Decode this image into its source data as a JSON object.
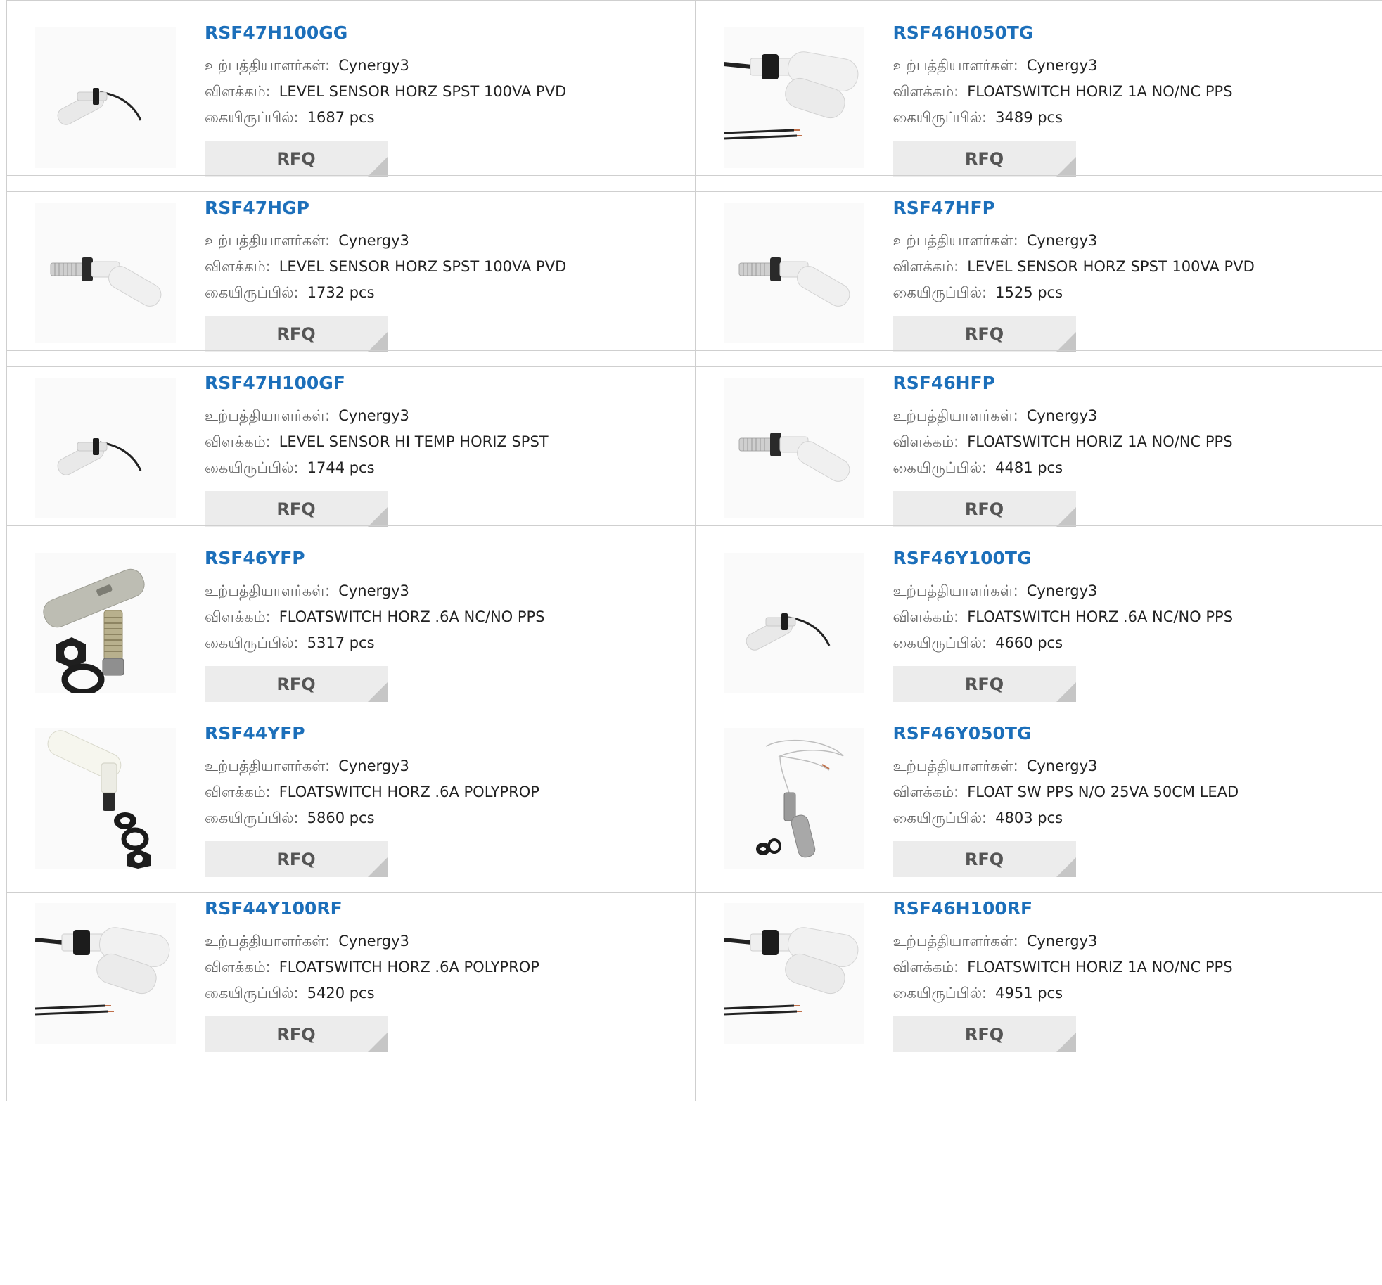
{
  "labels": {
    "manufacturer": "உற்பத்தியாளர்கள்:",
    "description": "விளக்கம்:",
    "stock": "கையிருப்பில்:",
    "rfq": "RFQ"
  },
  "products": [
    {
      "part": "RSF47H100GG",
      "manufacturer": "Cynergy3",
      "description": "LEVEL SENSOR HORZ SPST 100VA PVD",
      "stock": "1687 pcs",
      "image": "cable-float-icon"
    },
    {
      "part": "RSF46H050TG",
      "manufacturer": "Cynergy3",
      "description": "FLOATSWITCH HORIZ 1A NO/NC PPS",
      "stock": "3489 pcs",
      "image": "large-float-wires-icon"
    },
    {
      "part": "RSF47HGP",
      "manufacturer": "Cynergy3",
      "description": "LEVEL SENSOR HORZ SPST 100VA PVD",
      "stock": "1732 pcs",
      "image": "threaded-float-icon"
    },
    {
      "part": "RSF47HFP",
      "manufacturer": "Cynergy3",
      "description": "LEVEL SENSOR HORZ SPST 100VA PVD",
      "stock": "1525 pcs",
      "image": "threaded-float-icon"
    },
    {
      "part": "RSF47H100GF",
      "manufacturer": "Cynergy3",
      "description": "LEVEL SENSOR HI TEMP HORIZ SPST",
      "stock": "1744 pcs",
      "image": "cable-float-icon"
    },
    {
      "part": "RSF46HFP",
      "manufacturer": "Cynergy3",
      "description": "FLOATSWITCH HORIZ 1A NO/NC PPS",
      "stock": "4481 pcs",
      "image": "threaded-float-icon"
    },
    {
      "part": "RSF46YFP",
      "manufacturer": "Cynergy3",
      "description": "FLOATSWITCH HORZ .6A NC/NO PPS",
      "stock": "5317 pcs",
      "image": "connector-sensor-icon"
    },
    {
      "part": "RSF46Y100TG",
      "manufacturer": "Cynergy3",
      "description": "FLOATSWITCH HORZ .6A NC/NO PPS",
      "stock": "4660 pcs",
      "image": "cable-float-icon"
    },
    {
      "part": "RSF44YFP",
      "manufacturer": "Cynergy3",
      "description": "FLOATSWITCH HORZ .6A POLYPROP",
      "stock": "5860 pcs",
      "image": "white-float-nuts-icon"
    },
    {
      "part": "RSF46Y050TG",
      "manufacturer": "Cynergy3",
      "description": "FLOAT SW PPS N/O 25VA 50CM LEAD",
      "stock": "4803 pcs",
      "image": "vertical-float-lead-icon"
    },
    {
      "part": "RSF44Y100RF",
      "manufacturer": "Cynergy3",
      "description": "FLOATSWITCH HORZ .6A POLYPROP",
      "stock": "5420 pcs",
      "image": "large-float-wires-icon"
    },
    {
      "part": "RSF46H100RF",
      "manufacturer": "Cynergy3",
      "description": "FLOATSWITCH HORIZ 1A NO/NC PPS",
      "stock": "4951 pcs",
      "image": "large-float-wires-icon"
    }
  ]
}
